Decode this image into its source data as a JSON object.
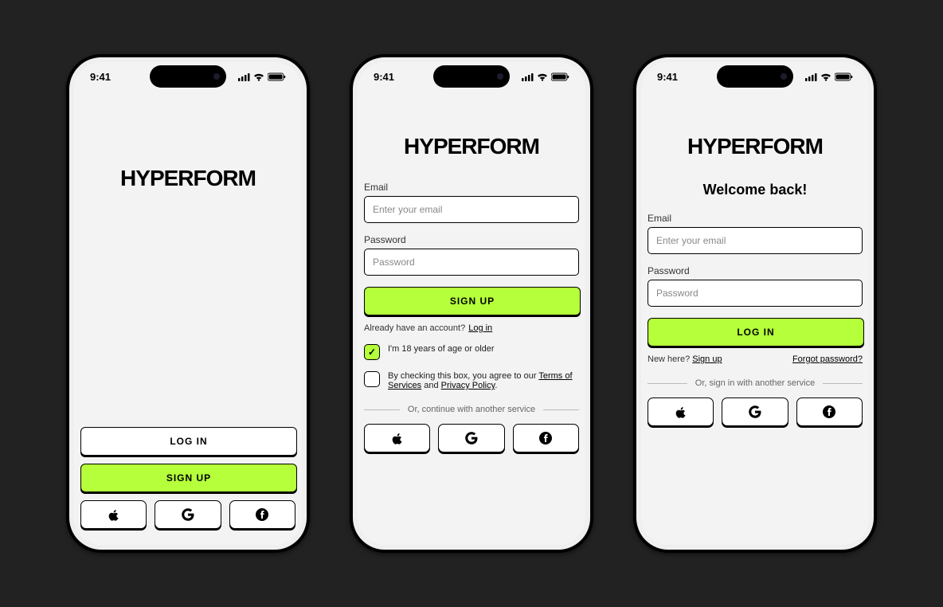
{
  "status": {
    "time": "9:41"
  },
  "brand": "HYPERFORM",
  "screen1": {
    "login_label": "LOG IN",
    "signup_label": "SIGN UP"
  },
  "screen2": {
    "email_label": "Email",
    "email_placeholder": "Enter your email",
    "password_label": "Password",
    "password_placeholder": "Password",
    "signup_label": "SIGN UP",
    "already_text": "Already have an account?",
    "login_link": "Log in",
    "age_text": "I'm 18 years of age or older",
    "age_checked": true,
    "terms_prefix": "By checking this box, you agree to our ",
    "terms_link": "Terms of Services",
    "terms_mid": " and ",
    "privacy_link": "Privacy Policy",
    "terms_suffix": ".",
    "divider_text": "Or, continue with another service"
  },
  "screen3": {
    "welcome": "Welcome back!",
    "email_label": "Email",
    "email_placeholder": "Enter your email",
    "password_label": "Password",
    "password_placeholder": "Password",
    "login_label": "LOG IN",
    "new_here": "New here?",
    "signup_link": "Sign up",
    "forgot_link": "Forgot password?",
    "divider_text": "Or, sign in with another service"
  },
  "social": {
    "apple": "apple-icon",
    "google": "google-icon",
    "facebook": "facebook-icon"
  }
}
